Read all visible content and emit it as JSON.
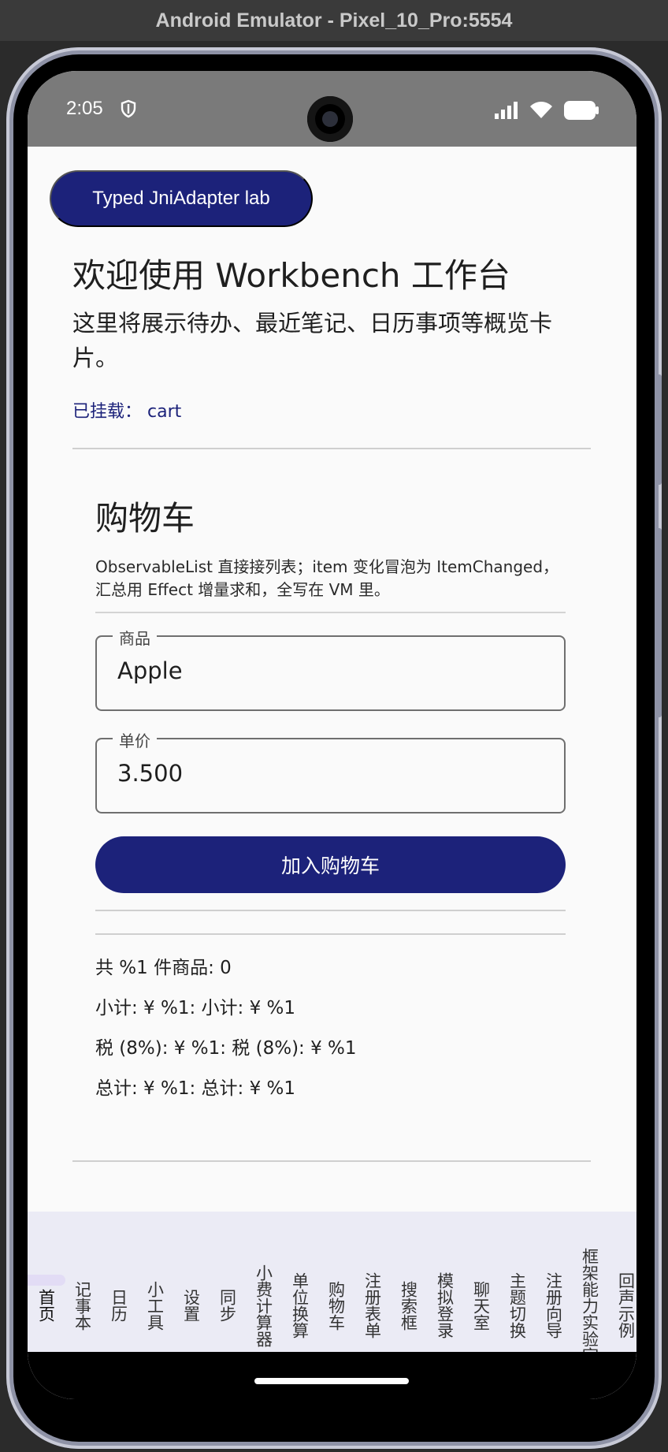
{
  "window": {
    "title": "Android Emulator - Pixel_10_Pro:5554"
  },
  "status_bar": {
    "time": "2:05"
  },
  "header": {
    "lab_button": "Typed JniAdapter lab",
    "welcome_title": "欢迎使用 Workbench 工作台",
    "description": "这里将展示待办、最近笔记、日历事项等概览卡片。",
    "mounted": "已挂载： cart"
  },
  "cart": {
    "title": "购物车",
    "description": "ObservableList 直接接列表；item 变化冒泡为 ItemChanged，汇总用 Effect 增量求和，全写在 VM 里。",
    "product_label": "商品",
    "product_value": "Apple",
    "price_label": "单价",
    "price_value": "3.500",
    "add_button": "加入购物车",
    "count_line": "共 %1 件商品: 0",
    "subtotal_line": "小计: ¥ %1: 小计: ¥ %1",
    "tax_line": "税 (8%): ¥ %1: 税 (8%): ¥ %1",
    "total_line": "总计: ¥ %1: 总计: ¥ %1"
  },
  "bottom_nav": {
    "items": [
      {
        "label": "首页"
      },
      {
        "label": "记事本"
      },
      {
        "label": "日历"
      },
      {
        "label": "小工具"
      },
      {
        "label": "设置"
      },
      {
        "label": "同步"
      },
      {
        "label": "小费计算器"
      },
      {
        "label": "单位换算"
      },
      {
        "label": "购物车"
      },
      {
        "label": "注册表单"
      },
      {
        "label": "搜索框"
      },
      {
        "label": "模拟登录"
      },
      {
        "label": "聊天室"
      },
      {
        "label": "主题切换"
      },
      {
        "label": "注册向导"
      },
      {
        "label": "框架能力实验室"
      },
      {
        "label": "回声示例"
      }
    ]
  },
  "colors": {
    "primary": "#1c227a",
    "nav_background": "#ebebf5",
    "status_bar": "#7a7a7a"
  }
}
